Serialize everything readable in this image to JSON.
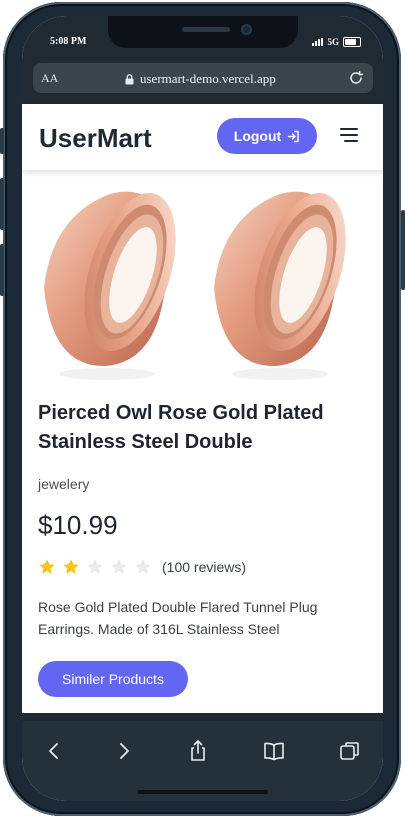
{
  "status": {
    "time": "5:08 PM",
    "network": "5G"
  },
  "browser": {
    "text_size": "AA",
    "url": "usermart-demo.vercel.app"
  },
  "navbar": {
    "brand": "UserMart",
    "logout_label": "Logout"
  },
  "product": {
    "title": "Pierced Owl Rose Gold Plated Stainless Steel Double",
    "category": "jewelery",
    "price": "$10.99",
    "rating": 2,
    "rating_max": 5,
    "reviews": "(100 reviews)",
    "description": "Rose Gold Plated Double Flared Tunnel Plug Earrings. Made of 316L Stainless Steel",
    "similar_label": "Similer Products"
  },
  "colors": {
    "accent": "#6366f1",
    "star_filled": "#f5c518",
    "star_empty": "#e9eaec"
  },
  "icons": {
    "lock": "lock-icon",
    "reload": "reload-icon",
    "logout": "logout-icon",
    "menu": "hamburger-menu-icon",
    "back": "back-icon",
    "forward": "forward-icon",
    "share": "share-icon",
    "bookmarks": "bookmarks-icon",
    "tabs": "tabs-icon"
  }
}
